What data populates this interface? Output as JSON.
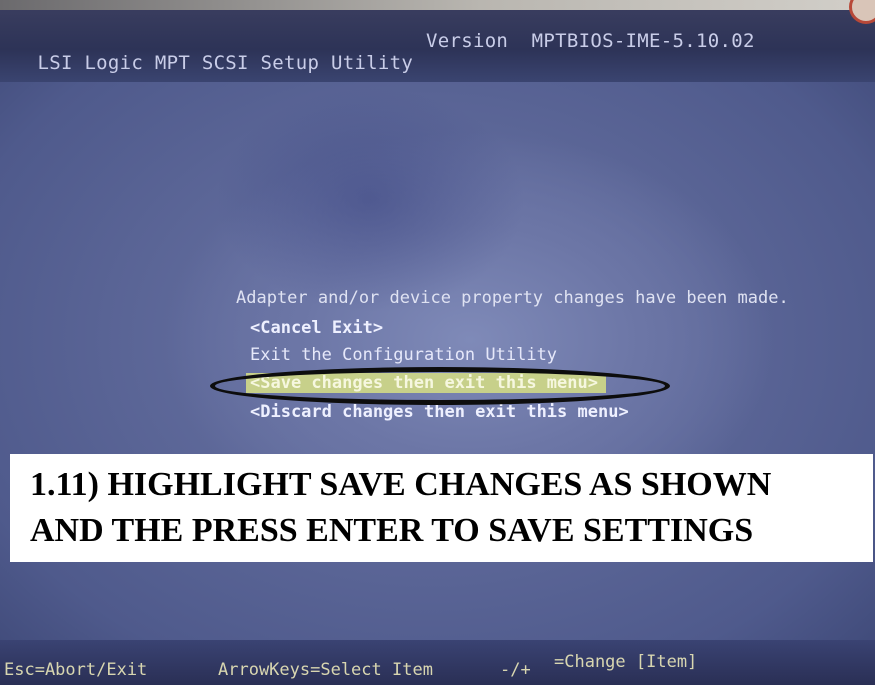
{
  "header": {
    "title": "LSI Logic MPT SCSI Setup Utility",
    "version": "Version  MPTBIOS-IME-5.10.02"
  },
  "dialog": {
    "message": "Adapter and/or device property changes have been made.",
    "items": [
      {
        "label": "<Cancel Exit>"
      },
      {
        "label": "Exit the Configuration Utility"
      },
      {
        "label": "<Save changes then exit this menu>"
      },
      {
        "label": "<Discard changes then exit this menu>"
      }
    ],
    "selected_index": 2
  },
  "annotation": {
    "line1": "1.11) HIGHLIGHT SAVE CHANGES AS SHOWN",
    "line2": "AND THE PRESS ENTER TO SAVE SETTINGS"
  },
  "status_bar": {
    "esc": "Esc=Abort/Exit",
    "arrows": "ArrowKeys=Select Item",
    "change_keys": "-/+",
    "change": "=Change [Item]"
  },
  "colors": {
    "screen_blue": "#6d77a7",
    "highlight_bg": "#c7d08a",
    "ring": "#0d0d0d",
    "annotation_bg": "#ffffff"
  }
}
